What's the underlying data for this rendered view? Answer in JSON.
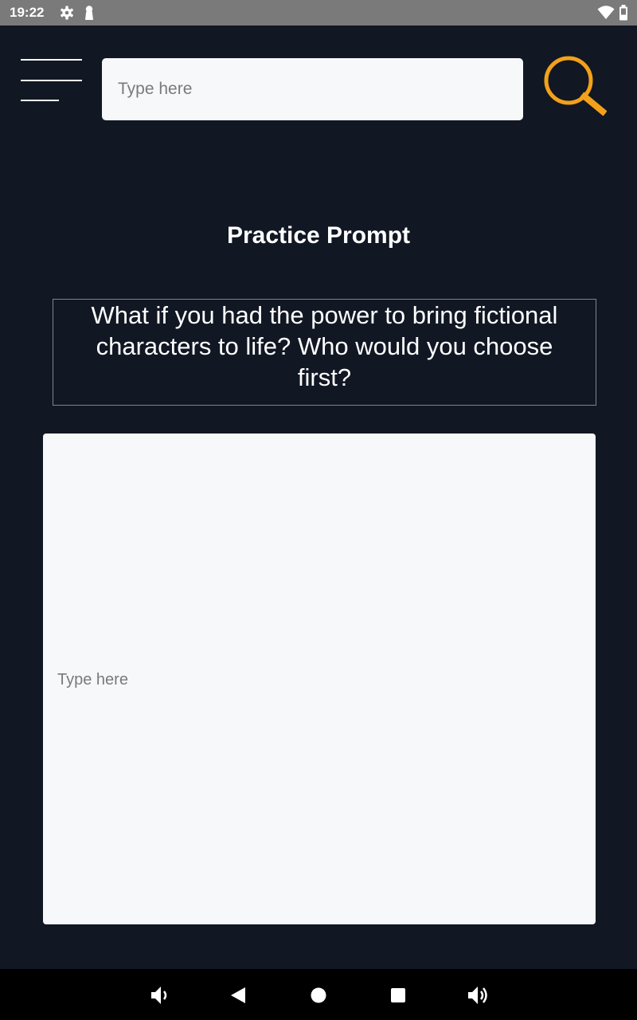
{
  "status_bar": {
    "time": "19:22",
    "icons": [
      "gear-icon",
      "keyhole-icon",
      "wifi-icon",
      "battery-icon"
    ]
  },
  "header": {
    "menu_icon": "hamburger-menu-icon",
    "search": {
      "placeholder": "Type here",
      "value": ""
    },
    "search_icon": "magnifier-icon"
  },
  "main": {
    "title": "Practice Prompt",
    "prompt": "What if you had the power to bring fictional characters to life? Who would you choose first?",
    "response": {
      "placeholder": "Type here",
      "value": ""
    }
  },
  "nav_bar": {
    "buttons": [
      "volume-down-icon",
      "back-icon",
      "home-icon",
      "recents-icon",
      "volume-up-icon"
    ]
  },
  "colors": {
    "background": "#111723",
    "accent": "#f3a11a",
    "field": "#f7f8fa",
    "status_bar": "#7a7a7a"
  }
}
